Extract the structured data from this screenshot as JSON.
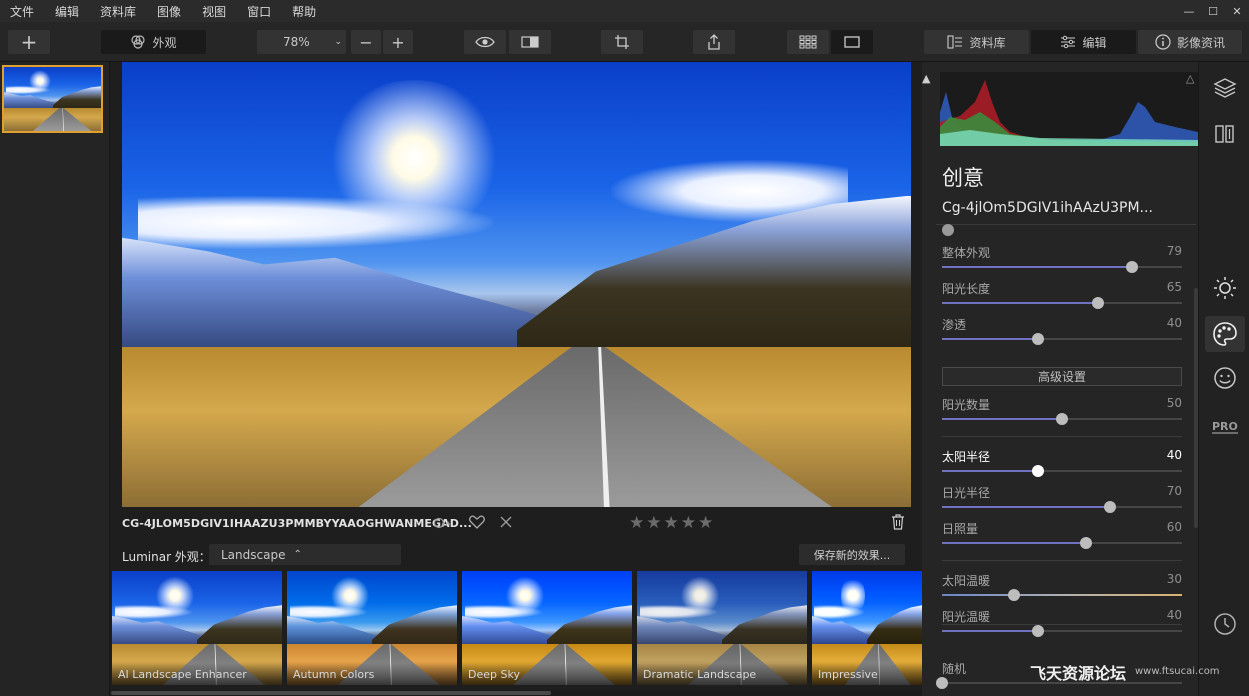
{
  "menu": [
    "文件",
    "编辑",
    "资料库",
    "图像",
    "视图",
    "窗口",
    "帮助"
  ],
  "toolbar": {
    "add_label": "+",
    "looks_label": "外观",
    "zoom_value": "78%",
    "zoom_out_label": "−",
    "zoom_in_label": "+",
    "library_tab": "资料库",
    "edit_tab": "编辑",
    "info_tab": "影像资讯"
  },
  "photo": {
    "filename": "CG-4JLOM5DGIV1IHAAZU3PMMBYYAAOGHWANMEGAD...",
    "rating_stars": "★★★★★"
  },
  "looks": {
    "title": "Luminar 外观：",
    "category": "Landscape",
    "save_label": "保存新的效果...",
    "items": [
      "AI Landscape Enhancer",
      "Autumn Colors",
      "Deep Sky",
      "Dramatic Landscape",
      "Impressive"
    ]
  },
  "panel": {
    "title": "创意",
    "preset_name": "Cg-4jlOm5DGIV1ihAAzU3PM...",
    "advanced_label": "高级设置",
    "sliders": [
      {
        "label": "整体外观",
        "value": "79",
        "fraction": 0.79
      },
      {
        "label": "阳光长度",
        "value": "65",
        "fraction": 0.65
      },
      {
        "label": "渗透",
        "value": "40",
        "fraction": 0.4
      },
      {
        "label": "阳光数量",
        "value": "50",
        "fraction": 0.5
      },
      {
        "label": "太阳半径",
        "value": "40",
        "fraction": 0.4
      },
      {
        "label": "日光半径",
        "value": "70",
        "fraction": 0.7
      },
      {
        "label": "日照量",
        "value": "60",
        "fraction": 0.6
      },
      {
        "label": "太阳温暖",
        "value": "30",
        "fraction": 0.3
      },
      {
        "label": "阳光温暖",
        "value": "40",
        "fraction": 0.4
      },
      {
        "label": "随机",
        "value": "",
        "fraction": 0.0
      }
    ]
  },
  "watermark": {
    "main": "飞天资源论坛",
    "sub": "www.ftsucai.com"
  },
  "colors": {
    "accent": "#6e72c0",
    "selection": "#e0a030"
  }
}
